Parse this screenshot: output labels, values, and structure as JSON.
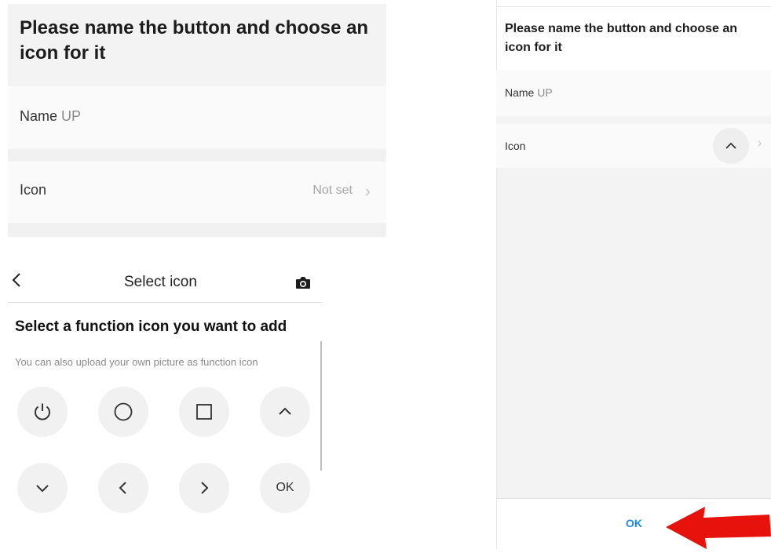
{
  "left_form": {
    "title": "Please name the button and choose an icon for it",
    "name_label": "Name",
    "name_value": "UP",
    "icon_label": "Icon",
    "icon_value": "Not set"
  },
  "select_icon": {
    "header_title": "Select icon",
    "heading": "Select a function icon you want to add",
    "subtext": "You can also upload your own picture as function icon",
    "icons": [
      {
        "name": "power-icon"
      },
      {
        "name": "circle-icon"
      },
      {
        "name": "square-icon"
      },
      {
        "name": "chevron-up-icon"
      },
      {
        "name": "chevron-down-icon"
      },
      {
        "name": "chevron-left-icon"
      },
      {
        "name": "chevron-right-icon"
      },
      {
        "name": "ok-icon",
        "label": "OK"
      }
    ]
  },
  "right_form": {
    "title": "Please name the button and choose an icon for it",
    "name_label": "Name",
    "name_value": "UP",
    "icon_label": "Icon",
    "selected_icon": "chevron-up-icon",
    "ok_label": "OK"
  },
  "annotation": {
    "arrow_color": "#e8120c",
    "points_to": "ok-button"
  },
  "colors": {
    "accent": "#1e88e5",
    "row_bg": "#fafafa",
    "section_bg": "#f3f3f3",
    "icon_bg": "#f1f1f1"
  }
}
